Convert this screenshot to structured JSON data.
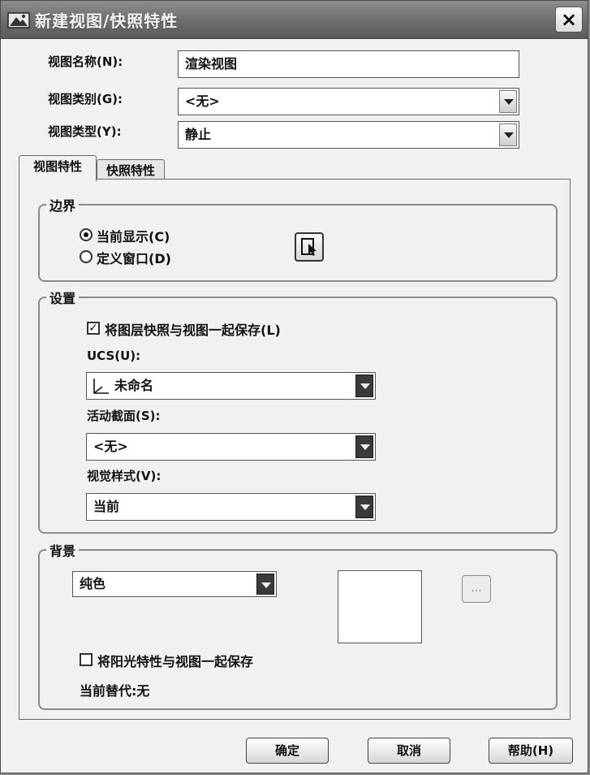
{
  "window": {
    "title": "新建视图/快照特性",
    "close_label": "×"
  },
  "fields": {
    "view_name_label": "视图名称(N):",
    "view_name_value": "渲染视图",
    "view_category_label": "视图类别(G):",
    "view_category_value": "<无>",
    "view_type_label": "视图类型(Y):",
    "view_type_value": "静止"
  },
  "tabs": [
    {
      "label": "视图特性",
      "active": true
    },
    {
      "label": "快照特性",
      "active": false
    }
  ],
  "boundary": {
    "title": "边界",
    "current_display_label": "当前显示(C)",
    "current_display_selected": true,
    "define_window_label": "定义窗口(D)",
    "define_window_selected": false
  },
  "settings": {
    "title": "设置",
    "save_layer_snapshot_label": "将图层快照与视图一起保存(L)",
    "save_layer_snapshot_checked": true,
    "ucs_label": "UCS(U):",
    "ucs_value": "未命名",
    "live_section_label": "活动截面(S):",
    "live_section_value": "<无>",
    "visual_style_label": "视觉样式(V):",
    "visual_style_value": "当前"
  },
  "background": {
    "title": "背景",
    "type_value": "纯色",
    "ellipsis_label": "...",
    "preview_color": "#ffffff",
    "save_sun_label": "将阳光特性与视图一起保存",
    "save_sun_checked": false,
    "current_override_label": "当前替代:无"
  },
  "buttons": {
    "ok": "确定",
    "cancel": "取消",
    "help": "帮助(H)"
  }
}
